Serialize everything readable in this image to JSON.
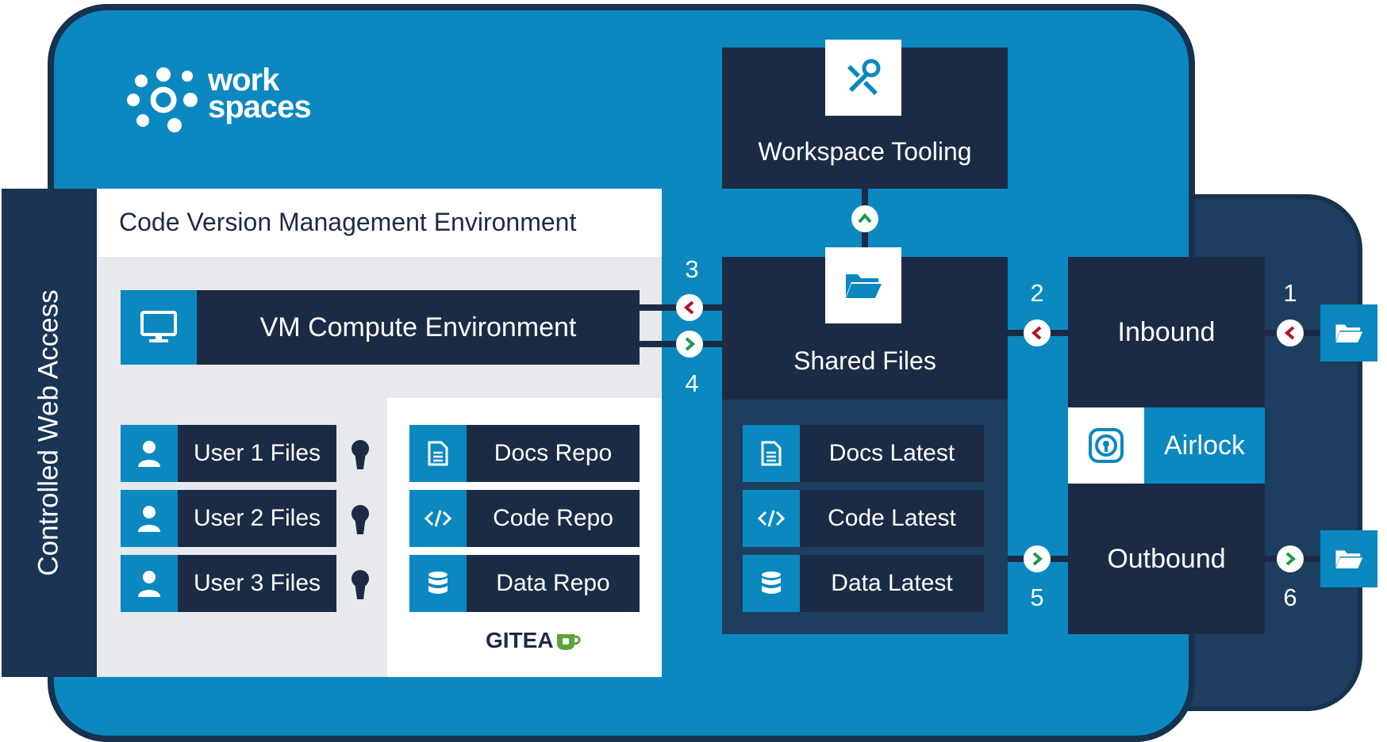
{
  "side_label": "Controlled Web Access",
  "logo": {
    "line1": "work",
    "line2": "spaces"
  },
  "code_env": {
    "title": "Code Version Management Environment",
    "vm_label": "VM Compute Environment",
    "users": [
      "User 1 Files",
      "User 2 Files",
      "User 3 Files"
    ],
    "repos": [
      "Docs Repo",
      "Code Repo",
      "Data Repo"
    ],
    "gitea_label": "GITEA"
  },
  "tooling": {
    "label": "Workspace Tooling"
  },
  "shared": {
    "label": "Shared Files",
    "items": [
      "Docs Latest",
      "Code Latest",
      "Data Latest"
    ]
  },
  "airlock": {
    "inbound": "Inbound",
    "airlock": "Airlock",
    "outbound": "Outbound"
  },
  "numbers": {
    "n1": "1",
    "n2": "2",
    "n3": "3",
    "n4": "4",
    "n5": "5",
    "n6": "6"
  },
  "colors": {
    "blue": "#0b88c0",
    "dark_navy": "#1c2b45",
    "border_navy": "#16324e",
    "gray_panel": "#e7e9ec",
    "arrow_in": "#b3132b",
    "arrow_out": "#1f9a4a",
    "gitea_green": "#5aa43c"
  },
  "icons": [
    "monitor-icon",
    "user-icon",
    "keyhole-icon",
    "document-icon",
    "code-icon",
    "database-icon",
    "tools-icon",
    "folder-icon",
    "airlock-icon",
    "chevron-left-icon",
    "chevron-right-icon",
    "chevron-up-icon"
  ]
}
